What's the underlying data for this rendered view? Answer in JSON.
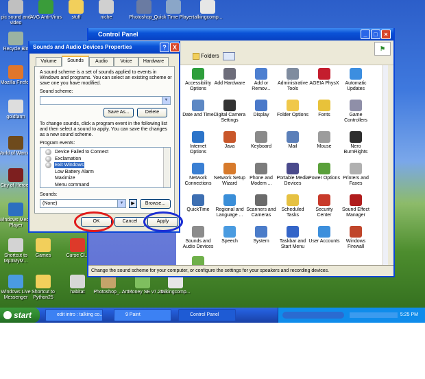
{
  "desktop": {
    "icons": [
      {
        "label": "pic sound and video",
        "color": "#c0c0c0"
      },
      {
        "label": "AVG Anti-Virus",
        "color": "#3a9c3a"
      },
      {
        "label": "stuff",
        "color": "#f2cf5b"
      },
      {
        "label": "niche",
        "color": "#d0d0d0"
      },
      {
        "label": "Photoshop_...",
        "color": "#6a7ba2"
      },
      {
        "label": "Quick Time Player",
        "color": "#8aa6c8"
      },
      {
        "label": "talkingcomp...",
        "color": "#e6e6e6"
      },
      {
        "label": "Recycle Bin",
        "color": "#9bb3a2"
      },
      {
        "label": "Mozilla Firefox",
        "color": "#e0762c"
      },
      {
        "label": "goldfarm",
        "color": "#dddddd"
      },
      {
        "label": "World of Warcraft",
        "color": "#6e4a1c"
      },
      {
        "label": "City of Heroes",
        "color": "#7d1f1f"
      },
      {
        "label": "Windows Media Player",
        "color": "#2d6fc0"
      },
      {
        "label": "Shortcut to Mp3MyM...",
        "color": "#d3d3d3"
      },
      {
        "label": "Games",
        "color": "#f2cf5b"
      },
      {
        "label": "Curse Cl...",
        "color": "#dd3a2a"
      },
      {
        "label": "Windows Live Messenger",
        "color": "#4a9be0"
      },
      {
        "label": "Shortcut to Python25",
        "color": "#f2cf5b"
      },
      {
        "label": "habitat",
        "color": "#d7d7d7"
      },
      {
        "label": "Photoshop_...",
        "color": "#c4a46a"
      },
      {
        "label": "ArtMoney SE v7.28",
        "color": "#7fbf5f"
      },
      {
        "label": "talkingcomp...",
        "color": "#e6e6e6"
      }
    ]
  },
  "control_panel": {
    "title": "Control Panel",
    "folders_label": "Folders",
    "status": "Change the sound scheme for your computer, or configure the settings for your speakers and recording devices.",
    "items": [
      {
        "label": "Accessibility Options",
        "color": "#2e9e3b"
      },
      {
        "label": "Add Hardware",
        "color": "#6d6d7a"
      },
      {
        "label": "Add or Remov...",
        "color": "#4d7fd0"
      },
      {
        "label": "Administrative Tools",
        "color": "#7f8c9f"
      },
      {
        "label": "AGEIA PhysX",
        "color": "#c41d2e"
      },
      {
        "label": "Automatic Updates",
        "color": "#3c8ee0"
      },
      {
        "label": "Date and Time",
        "color": "#5d88c4"
      },
      {
        "label": "Digital Camera Settings",
        "color": "#333333"
      },
      {
        "label": "Display",
        "color": "#4a79c9"
      },
      {
        "label": "Folder Options",
        "color": "#f0c84a"
      },
      {
        "label": "Fonts",
        "color": "#e8c23a"
      },
      {
        "label": "Game Controllers",
        "color": "#8f8fa8"
      },
      {
        "label": "Internet Options",
        "color": "#2c74c9"
      },
      {
        "label": "Java",
        "color": "#c9572a"
      },
      {
        "label": "Keyboard",
        "color": "#8a8a8a"
      },
      {
        "label": "Mail",
        "color": "#5b7fb9"
      },
      {
        "label": "Mouse",
        "color": "#9c9c9c"
      },
      {
        "label": "Nero BurnRights",
        "color": "#2d2d2d"
      },
      {
        "label": "Network Connections",
        "color": "#3a7fd3"
      },
      {
        "label": "Network Setup Wizard",
        "color": "#d77a2b"
      },
      {
        "label": "Phone and Modem ...",
        "color": "#7c7c7c"
      },
      {
        "label": "Portable Media Devices",
        "color": "#4a4a8c"
      },
      {
        "label": "Power Options",
        "color": "#5aa03a"
      },
      {
        "label": "Printers and Faxes",
        "color": "#b0b0b0"
      },
      {
        "label": "QuickTime",
        "color": "#3d6fb2"
      },
      {
        "label": "Regional and Language ...",
        "color": "#3a8ed8"
      },
      {
        "label": "Scanners and Cameras",
        "color": "#6b6b6b"
      },
      {
        "label": "Scheduled Tasks",
        "color": "#e6c142"
      },
      {
        "label": "Security Center",
        "color": "#c83a2a"
      },
      {
        "label": "Sound Effect Manager",
        "color": "#b01c1c"
      },
      {
        "label": "Sounds and Audio Devices",
        "color": "#8c8c8c"
      },
      {
        "label": "Speech",
        "color": "#4a9be0"
      },
      {
        "label": "System",
        "color": "#4b7cc9"
      },
      {
        "label": "Taskbar and Start Menu",
        "color": "#3465c8"
      },
      {
        "label": "User Accounts",
        "color": "#3d8fdc"
      },
      {
        "label": "Windows Firewall",
        "color": "#c0452a"
      },
      {
        "label": "",
        "color": "#6fb04a"
      }
    ]
  },
  "dialog": {
    "title": "Sounds and Audio Devices Properties",
    "help": "?",
    "close": "X",
    "tabs": [
      "Volume",
      "Sounds",
      "Audio",
      "Voice",
      "Hardware"
    ],
    "intro": "A sound scheme is a set of sounds applied to events in Windows and programs. You can select an existing scheme or save one you have modified.",
    "scheme_label": "Sound scheme:",
    "scheme_value": "",
    "save_as": "Save As...",
    "delete": "Delete",
    "change_text": "To change sounds, click a program event in the following list and then select a sound to apply. You can save the changes as a new sound scheme.",
    "events_label": "Program events:",
    "events": [
      "Device Failed to Connect",
      "Exclamation",
      "Exit Windows",
      "Low Battery Alarm",
      "Maximize",
      "Menu command"
    ],
    "selected_event": "Exit Windows",
    "sounds_label": "Sounds:",
    "sounds_value": "(None)",
    "browse": "Browse...",
    "ok": "OK",
    "cancel": "Cancel",
    "apply": "Apply"
  },
  "annotations": {
    "ok_ring_color": "#e01b1b",
    "apply_ring_color": "#1b2ed4"
  },
  "taskbar": {
    "start": "start",
    "tasks": [
      "edit intro : talking co...",
      "9 Paint",
      "Control Panel"
    ],
    "clock": "5:25 PM"
  }
}
